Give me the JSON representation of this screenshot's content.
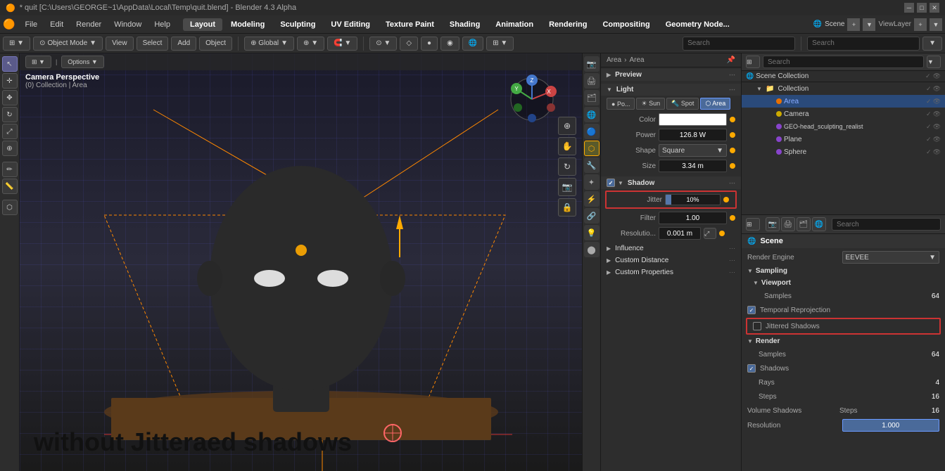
{
  "window": {
    "title": "* quit [C:\\Users\\GEORGE~1\\AppData\\Local\\Temp\\quit.blend] - Blender 4.3 Alpha",
    "controls": [
      "minimize",
      "maximize",
      "close"
    ]
  },
  "menu": {
    "blender_icon": "🟠",
    "items": [
      "File",
      "Edit",
      "Render",
      "Window",
      "Help"
    ],
    "workspaces": [
      "Layout",
      "Modeling",
      "Sculpting",
      "UV Editing",
      "Texture Paint",
      "Shading",
      "Animation",
      "Rendering",
      "Compositing",
      "Geometry Node..."
    ]
  },
  "toolbar": {
    "mode_btn": "Object Mode",
    "view_label": "View",
    "select_label": "Select",
    "add_label": "Add",
    "object_label": "Object",
    "transform_global": "⊕ Global",
    "search_placeholder1": "Search",
    "search_placeholder2": "Search"
  },
  "viewport": {
    "camera_text": "Camera Perspective",
    "collection_text": "(0) Collection | Area",
    "overlay_text": "without Jitteraed shadows",
    "gizmo_buttons": [
      "🔲",
      "👁",
      "↕",
      "🔀",
      "📐",
      "💡",
      "📷",
      "🔒"
    ],
    "right_tools": [
      "↕",
      "↔",
      "↗",
      "⊕",
      "🔍",
      "📷",
      "🔒"
    ]
  },
  "header_breadcrumb": {
    "area1": "Area",
    "arrow": "›",
    "area2": "Area"
  },
  "light_panel": {
    "preview_label": "Preview",
    "light_label": "Light",
    "light_types": [
      "Po...",
      "Sun",
      "Spot",
      "Area"
    ],
    "active_type": "Area",
    "color_label": "Color",
    "power_label": "Power",
    "power_value": "126.8 W",
    "shape_label": "Shape",
    "shape_value": "Square",
    "size_label": "Size",
    "size_value": "3.34 m",
    "shadow_label": "Shadow",
    "jitter_label": "Jitter",
    "jitter_pct": "10%",
    "filter_label": "Filter",
    "filter_value": "1.00",
    "resolution_label": "Resolutio...",
    "resolution_value": "0.001 m",
    "influence_label": "Influence",
    "custom_distance_label": "Custom Distance",
    "custom_props_label": "Custom Properties"
  },
  "scene_name": "Scene",
  "scene_collection": "Scene Collection",
  "outliner": {
    "search_placeholder": "Search",
    "filter_icon": "▼",
    "collection_label": "Collection",
    "items": [
      {
        "name": "Area",
        "icon": "💡",
        "indent": 2,
        "selected": true
      },
      {
        "name": "Camera",
        "icon": "📷",
        "indent": 2,
        "selected": false
      },
      {
        "name": "GEO-head_sculpting_realist",
        "icon": "🔺",
        "indent": 2,
        "selected": false
      },
      {
        "name": "Plane",
        "icon": "🔺",
        "indent": 2,
        "selected": false
      },
      {
        "name": "Sphere",
        "icon": "🔺",
        "indent": 2,
        "selected": false
      }
    ]
  },
  "scene_props": {
    "search_placeholder": "Search",
    "scene_label": "Scene",
    "render_engine_label": "Render Engine",
    "render_engine_value": "EEVEE",
    "sampling_label": "Sampling",
    "viewport_label": "Viewport",
    "samples_label": "Samples",
    "samples_value": "64",
    "temporal_reprojection_label": "Temporal Reprojection",
    "jittered_shadows_label": "Jittered Shadows",
    "render_label": "Render",
    "render_samples_label": "Samples",
    "render_samples_value": "64",
    "shadows_label": "Shadows",
    "rays_label": "Rays",
    "rays_value": "4",
    "steps_label": "Steps",
    "steps_value": "16",
    "volume_shadows_label": "Volume Shadows",
    "volume_steps_label": "Steps",
    "volume_steps_value": "16",
    "resolution_label": "Resolution",
    "resolution_value": "1.000"
  },
  "colors": {
    "accent_blue": "#4a6a9a",
    "accent_orange": "#e87000",
    "highlight_red": "#cc3333",
    "selected_blue": "#2a4a7a",
    "active_yellow": "#ffaa00"
  }
}
